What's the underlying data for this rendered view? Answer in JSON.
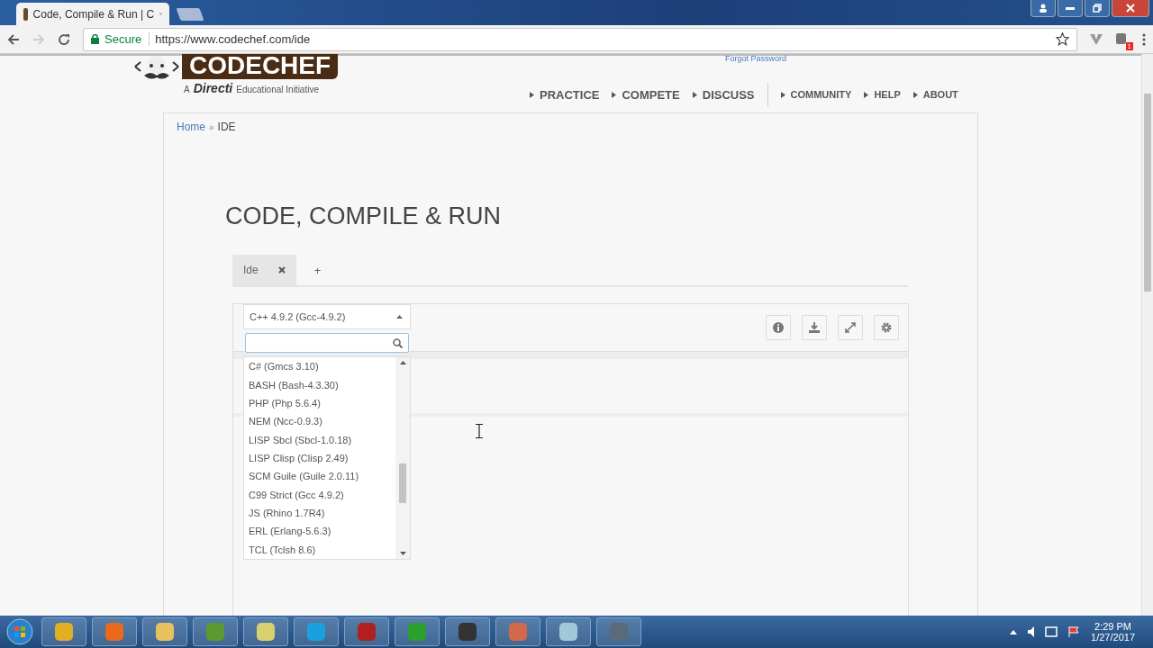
{
  "browser": {
    "tab_title": "Code, Compile & Run | C",
    "secure_label": "Secure",
    "url": "https://www.codechef.com/ide",
    "extension_badge": "1"
  },
  "header": {
    "logo": "CODECHEF",
    "tagline_prefix": "A",
    "tagline_brand": "Directi",
    "tagline": "Educational Initiative",
    "forgot_link": "Forgot Password",
    "nav": [
      {
        "label": "PRACTICE",
        "kind": "major"
      },
      {
        "label": "COMPETE",
        "kind": "major"
      },
      {
        "label": "DISCUSS",
        "kind": "major"
      },
      {
        "label": "COMMUNITY",
        "kind": "minor"
      },
      {
        "label": "HELP",
        "kind": "minor"
      },
      {
        "label": "ABOUT",
        "kind": "minor"
      }
    ]
  },
  "breadcrumb": {
    "items": [
      "Home",
      "IDE"
    ],
    "separator": "»"
  },
  "heading": "CODE, COMPILE & RUN",
  "tabs": [
    {
      "label": "Ide",
      "selected": true
    }
  ],
  "add_tab": "+",
  "language_select": {
    "value": "C++ 4.9.2 (Gcc-4.9.2)",
    "expanded": true,
    "options": [
      {
        "label": "C# (Gmcs 3.10)"
      },
      {
        "label": "BASH (Bash-4.3.30)"
      },
      {
        "label": "PHP (Php 5.6.4)"
      },
      {
        "label": "NEM (Ncc-0.9.3)"
      },
      {
        "label": "LISP Sbcl (Sbcl-1.0.18)"
      },
      {
        "label": "LISP Clisp (Clisp 2.49)"
      },
      {
        "label": "SCM Guile (Guile 2.0.11)"
      },
      {
        "label": "C99 Strict (Gcc 4.9.2)"
      },
      {
        "label": "JS (Rhino 1.7R4)"
      },
      {
        "label": "ERL (Erlang-5.6.3)"
      },
      {
        "label": "TCL (Tclsh 8.6)"
      }
    ]
  },
  "taskbar": {
    "time": "2:29 PM",
    "date": "1/27/2017"
  }
}
